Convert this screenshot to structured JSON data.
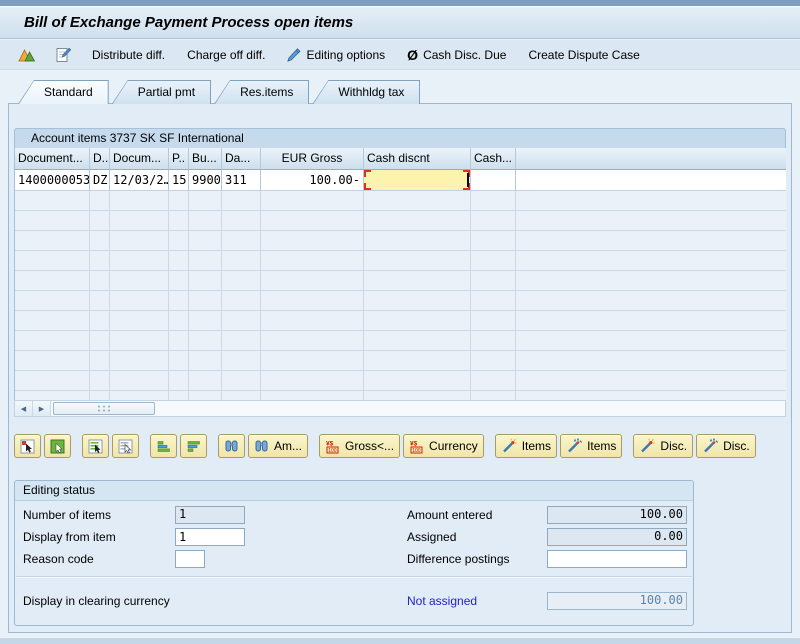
{
  "window": {
    "title": "Bill of Exchange Payment Process open items"
  },
  "toolbar": {
    "buttons": [
      {
        "label": "Distribute diff."
      },
      {
        "label": "Charge off diff."
      },
      {
        "label": "Editing options",
        "icon": "pencil-icon"
      },
      {
        "label": "Cash Disc. Due",
        "icon": "slashed-o-icon",
        "glyph": "Ø"
      },
      {
        "label": "Create Dispute Case"
      }
    ]
  },
  "tabs": [
    {
      "label": "Standard",
      "active": true
    },
    {
      "label": "Partial pmt",
      "active": false
    },
    {
      "label": "Res.items",
      "active": false
    },
    {
      "label": "Withhldg tax",
      "active": false
    }
  ],
  "table": {
    "caption": "Account items 3737 SK SF International",
    "columns": [
      "Document...",
      "D..",
      "Docum...",
      "P..",
      "Bu...",
      "Da...",
      "EUR Gross",
      "Cash discnt",
      "Cash..."
    ],
    "row": {
      "document": "1400000053",
      "doc_type": "DZ",
      "doc_date": "12/03/2…",
      "p": "15",
      "bu": "9900",
      "da": "311",
      "eur_gross": "100.00-",
      "cash_discnt": "",
      "cash": ""
    },
    "empty_row_count": 10
  },
  "grid_toolbar": {
    "find_amount_label": "Am...",
    "gross_label": "Gross<...",
    "currency_label": "Currency",
    "items_activate_label": "Items",
    "items_deactivate_label": "Items",
    "disc_activate_label": "Disc.",
    "disc_deactivate_label": "Disc."
  },
  "editing_status": {
    "title": "Editing status",
    "number_of_items": {
      "label": "Number of items",
      "value": "1"
    },
    "display_from_item": {
      "label": "Display from item",
      "value": "1"
    },
    "reason_code": {
      "label": "Reason code",
      "value": ""
    },
    "amount_entered": {
      "label": "Amount entered",
      "value": "100.00"
    },
    "assigned": {
      "label": "Assigned",
      "value": "0.00"
    },
    "difference_postings": {
      "label": "Difference postings",
      "value": ""
    },
    "clearing_currency_label": "Display in clearing currency",
    "not_assigned_link": "Not assigned",
    "not_assigned_value": "100.00"
  },
  "colors": {
    "selected_cell": "#fcf3ae",
    "selection_marker": "#e03020",
    "link_blue": "#2222cc",
    "button_yellow": "#f5ecb8"
  }
}
